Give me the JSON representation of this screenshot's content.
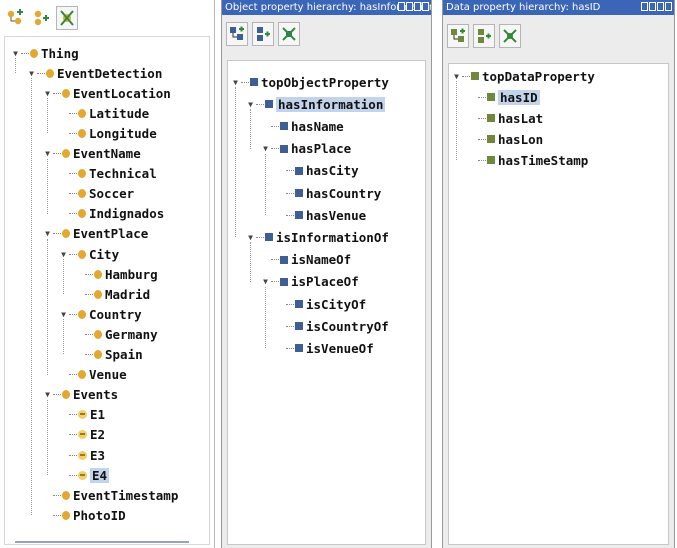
{
  "colors": {
    "title_bar": "#3b66b8",
    "class_icon": "#e5a730",
    "individual_icon": "#f2cf68",
    "object_property_icon": "#3d5f96",
    "data_property_icon": "#70883b",
    "selection": "#c4d3ec"
  },
  "class_panel": {
    "toolbar_icons": [
      "add-subclass-icon",
      "add-sibling-class-icon",
      "delete-class-icon"
    ],
    "tree": [
      {
        "label": "Thing",
        "icon": "class",
        "expanded": true
      },
      {
        "label": "EventDetection",
        "icon": "class",
        "expanded": true
      },
      {
        "label": "EventLocation",
        "icon": "class",
        "expanded": true
      },
      {
        "label": "Latitude",
        "icon": "class"
      },
      {
        "label": "Longitude",
        "icon": "class"
      },
      {
        "label": "EventName",
        "icon": "class",
        "expanded": true
      },
      {
        "label": "Technical",
        "icon": "class"
      },
      {
        "label": "Soccer",
        "icon": "class"
      },
      {
        "label": "Indignados",
        "icon": "class"
      },
      {
        "label": "EventPlace",
        "icon": "class",
        "expanded": true
      },
      {
        "label": "City",
        "icon": "class",
        "expanded": true
      },
      {
        "label": "Hamburg",
        "icon": "class"
      },
      {
        "label": "Madrid",
        "icon": "class"
      },
      {
        "label": "Country",
        "icon": "class",
        "expanded": true
      },
      {
        "label": "Germany",
        "icon": "class"
      },
      {
        "label": "Spain",
        "icon": "class"
      },
      {
        "label": "Venue",
        "icon": "class"
      },
      {
        "label": "Events",
        "icon": "class",
        "expanded": true
      },
      {
        "label": "E1",
        "icon": "individual"
      },
      {
        "label": "E2",
        "icon": "individual"
      },
      {
        "label": "E3",
        "icon": "individual"
      },
      {
        "label": "E4",
        "icon": "individual",
        "selected": true
      },
      {
        "label": "EventTimestamp",
        "icon": "class"
      },
      {
        "label": "PhotoID",
        "icon": "class"
      }
    ]
  },
  "object_panel": {
    "title": "Object property hierarchy: hasInformation",
    "toolbar_icons": [
      "add-sub-property-icon",
      "add-sibling-property-icon",
      "delete-property-icon"
    ],
    "tree": [
      {
        "label": "topObjectProperty",
        "expanded": true
      },
      {
        "label": "hasInformation",
        "expanded": true,
        "selected": true
      },
      {
        "label": "hasName"
      },
      {
        "label": "hasPlace",
        "expanded": true
      },
      {
        "label": "hasCity"
      },
      {
        "label": "hasCountry"
      },
      {
        "label": "hasVenue"
      },
      {
        "label": "isInformationOf",
        "expanded": true
      },
      {
        "label": "isNameOf"
      },
      {
        "label": "isPlaceOf",
        "expanded": true
      },
      {
        "label": "isCityOf"
      },
      {
        "label": "isCountryOf"
      },
      {
        "label": "isVenueOf"
      }
    ]
  },
  "data_panel": {
    "title": "Data property hierarchy: hasID",
    "toolbar_icons": [
      "add-sub-property-icon",
      "add-sibling-property-icon",
      "delete-property-icon"
    ],
    "tree": [
      {
        "label": "topDataProperty",
        "expanded": true
      },
      {
        "label": "hasID",
        "selected": true
      },
      {
        "label": "hasLat"
      },
      {
        "label": "hasLon"
      },
      {
        "label": "hasTimeStamp"
      }
    ]
  }
}
